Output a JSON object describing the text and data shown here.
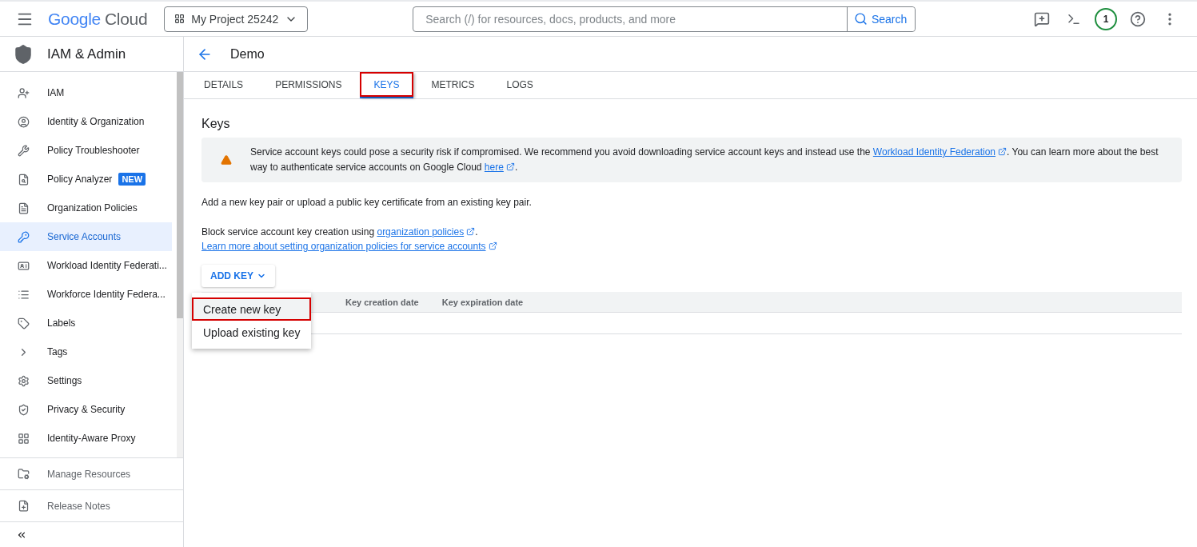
{
  "header": {
    "brand": {
      "google": "Google",
      "cloud": "Cloud"
    },
    "project": "My Project 25242",
    "search": {
      "placeholder": "Search (/) for resources, docs, products, and more",
      "button": "Search"
    },
    "notification_count": "1"
  },
  "sidebar": {
    "title": "IAM & Admin",
    "items": [
      {
        "label": "IAM",
        "selected": false
      },
      {
        "label": "Identity & Organization",
        "selected": false
      },
      {
        "label": "Policy Troubleshooter",
        "selected": false
      },
      {
        "label": "Policy Analyzer",
        "badge": "NEW",
        "selected": false
      },
      {
        "label": "Organization Policies",
        "selected": false
      },
      {
        "label": "Service Accounts",
        "selected": true
      },
      {
        "label": "Workload Identity Federati...",
        "selected": false
      },
      {
        "label": "Workforce Identity Federa...",
        "selected": false
      },
      {
        "label": "Labels",
        "selected": false
      },
      {
        "label": "Tags",
        "selected": false
      },
      {
        "label": "Settings",
        "selected": false
      },
      {
        "label": "Privacy & Security",
        "selected": false
      },
      {
        "label": "Identity-Aware Proxy",
        "selected": false
      }
    ],
    "footer": [
      "Manage Resources",
      "Release Notes"
    ]
  },
  "page": {
    "title": "Demo",
    "tabs": [
      {
        "label": "DETAILS",
        "selected": false,
        "highlighted": false
      },
      {
        "label": "PERMISSIONS",
        "selected": false,
        "highlighted": false
      },
      {
        "label": "KEYS",
        "selected": true,
        "highlighted": true
      },
      {
        "label": "METRICS",
        "selected": false,
        "highlighted": false
      },
      {
        "label": "LOGS",
        "selected": false,
        "highlighted": false
      }
    ],
    "heading": "Keys",
    "warning": [
      {
        "kind": "text",
        "text": "Service account keys could pose a security risk if compromised. We recommend you avoid downloading service account keys and instead use the "
      },
      {
        "kind": "link",
        "text": "Workload Identity Federation"
      },
      {
        "kind": "text",
        "text": ". You can learn more about the best way to authenticate service accounts on Google Cloud "
      },
      {
        "kind": "link",
        "text": "here"
      },
      {
        "kind": "text",
        "text": "."
      }
    ],
    "intro": "Add a new key pair or upload a public key certificate from an existing key pair.",
    "policy_line": [
      {
        "kind": "text",
        "text": "Block service account key creation using "
      },
      {
        "kind": "link",
        "text": "organization policies"
      },
      {
        "kind": "text",
        "text": "."
      }
    ],
    "learn_more": "Learn more about setting organization policies for service accounts",
    "add_key": "ADD KEY",
    "menu": [
      {
        "label": "Create new key",
        "highlighted": true
      },
      {
        "label": "Upload existing key",
        "highlighted": false
      }
    ],
    "table": {
      "columns": [
        "Key creation date",
        "Key expiration date"
      ]
    }
  }
}
